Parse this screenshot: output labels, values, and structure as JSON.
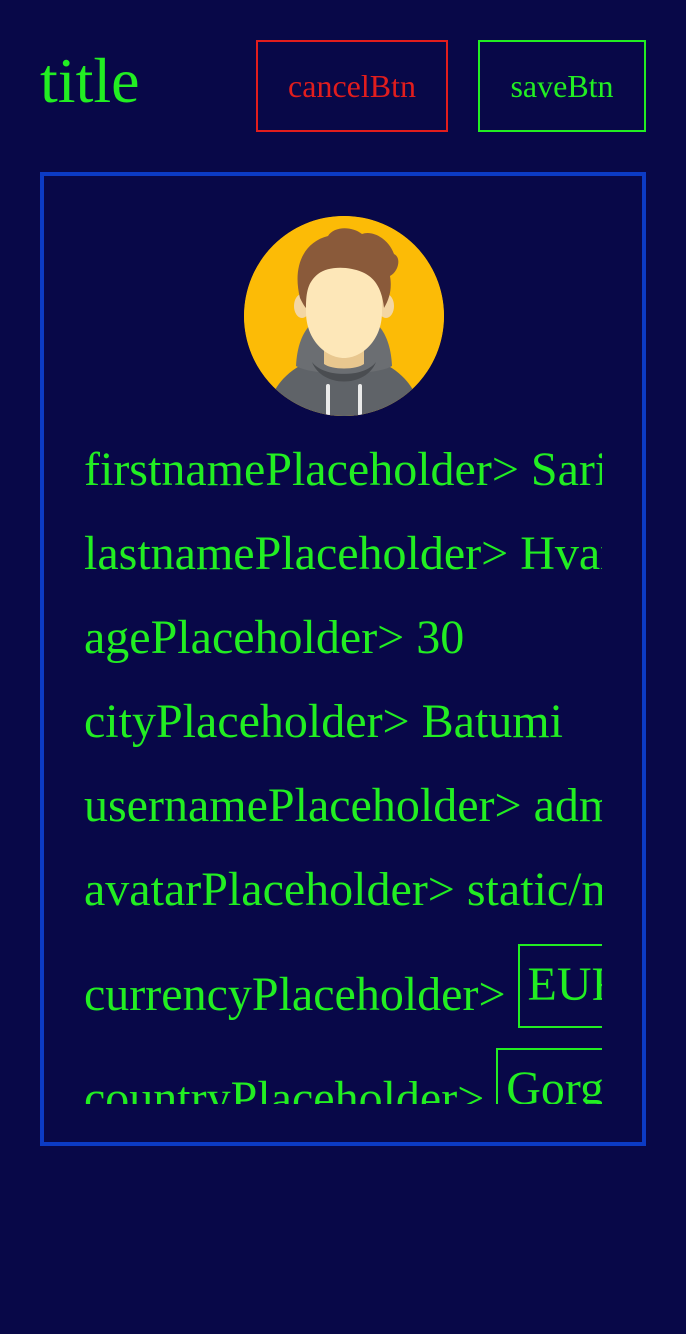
{
  "header": {
    "title": "title",
    "cancel_label": "cancelBtn",
    "save_label": "saveBtn"
  },
  "profile": {
    "avatar_icon": "user-avatar-hoodie-icon",
    "fields": {
      "firstname": {
        "label": "firstnamePlaceholder>",
        "value": "Sarik"
      },
      "lastname": {
        "label": "lastnamePlaceholder>",
        "value": "Hvar"
      },
      "age": {
        "label": "agePlaceholder>",
        "value": "30"
      },
      "city": {
        "label": "cityPlaceholder>",
        "value": "Batumi"
      },
      "username": {
        "label": "usernamePlaceholder>",
        "value": "admin"
      },
      "avatar": {
        "label": "avatarPlaceholder>",
        "value": "static/m"
      },
      "currency": {
        "label": "currencyPlaceholder>",
        "value": "EUR"
      },
      "country": {
        "label": "countryPlaceholder>",
        "value": "Gorg"
      }
    }
  },
  "colors": {
    "background": "#080848",
    "text": "#22ee22",
    "cancel": "#e11d1d",
    "card_border": "#0c3bc4",
    "avatar_bg": "#fcbb06"
  }
}
